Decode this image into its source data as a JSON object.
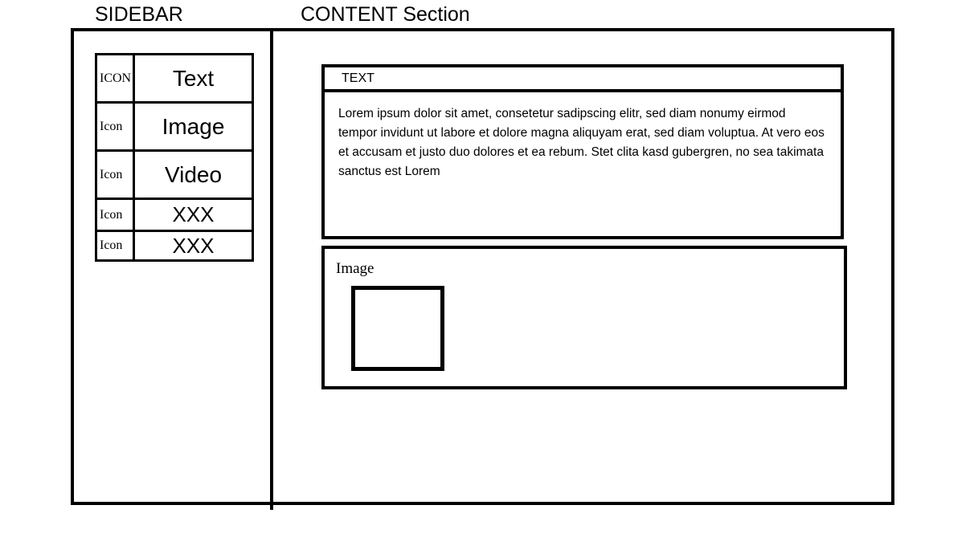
{
  "captions": {
    "sidebar": "SIDEBAR",
    "content": "CONTENT Section"
  },
  "sidebar": {
    "menu_items": [
      {
        "icon_label": "ICON",
        "label": "Text",
        "size": "tall"
      },
      {
        "icon_label": "Icon",
        "label": "Image",
        "size": "tall"
      },
      {
        "icon_label": "Icon",
        "label": "Video",
        "size": "tall"
      },
      {
        "icon_label": "Icon",
        "label": "XXX",
        "size": "short"
      },
      {
        "icon_label": "Icon",
        "label": "XXX",
        "size": "short"
      }
    ]
  },
  "content": {
    "text_card": {
      "header": "TEXT",
      "paragraph": "Lorem ipsum dolor sit amet, consetetur sadipscing elitr, sed diam nonumy eirmod tempor invidunt ut labore et dolore magna aliquyam erat, sed diam voluptua. At vero eos et accusam et justo duo dolores et ea rebum. Stet clita kasd gubergren, no sea takimata sanctus est Lorem"
    },
    "image_card": {
      "label": "Image",
      "placeholder_alt": "image-placeholder"
    }
  },
  "colors": {
    "stroke": "#000000",
    "background": "#ffffff"
  }
}
